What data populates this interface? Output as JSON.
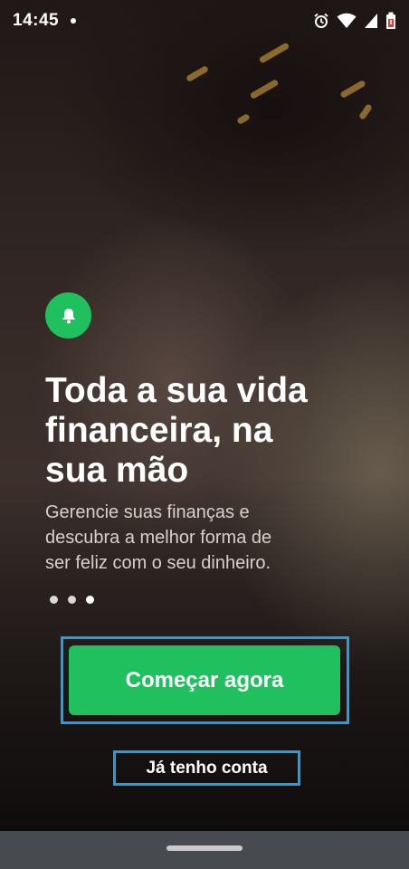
{
  "status_bar": {
    "time": "14:45",
    "icons": [
      "notification-dot-icon",
      "alarm-icon",
      "wifi-icon",
      "signal-icon",
      "battery-low-icon"
    ]
  },
  "hero": {
    "badge_icon": "bell-icon",
    "headline": "Toda a sua vida\nfinanceira, na\nsua mão",
    "subtitle": "Gerencie suas finanças e\ndescubra a melhor forma de\nser feliz com o seu dinheiro.",
    "page_indicator": {
      "count": 3,
      "active_index": 2
    }
  },
  "actions": {
    "start_label": "Começar agora",
    "login_label": "Já tenho conta"
  },
  "colors": {
    "accent_green": "#21c05f",
    "highlight_blue": "#1ea0e6",
    "nav_bar": "#474b4f"
  }
}
